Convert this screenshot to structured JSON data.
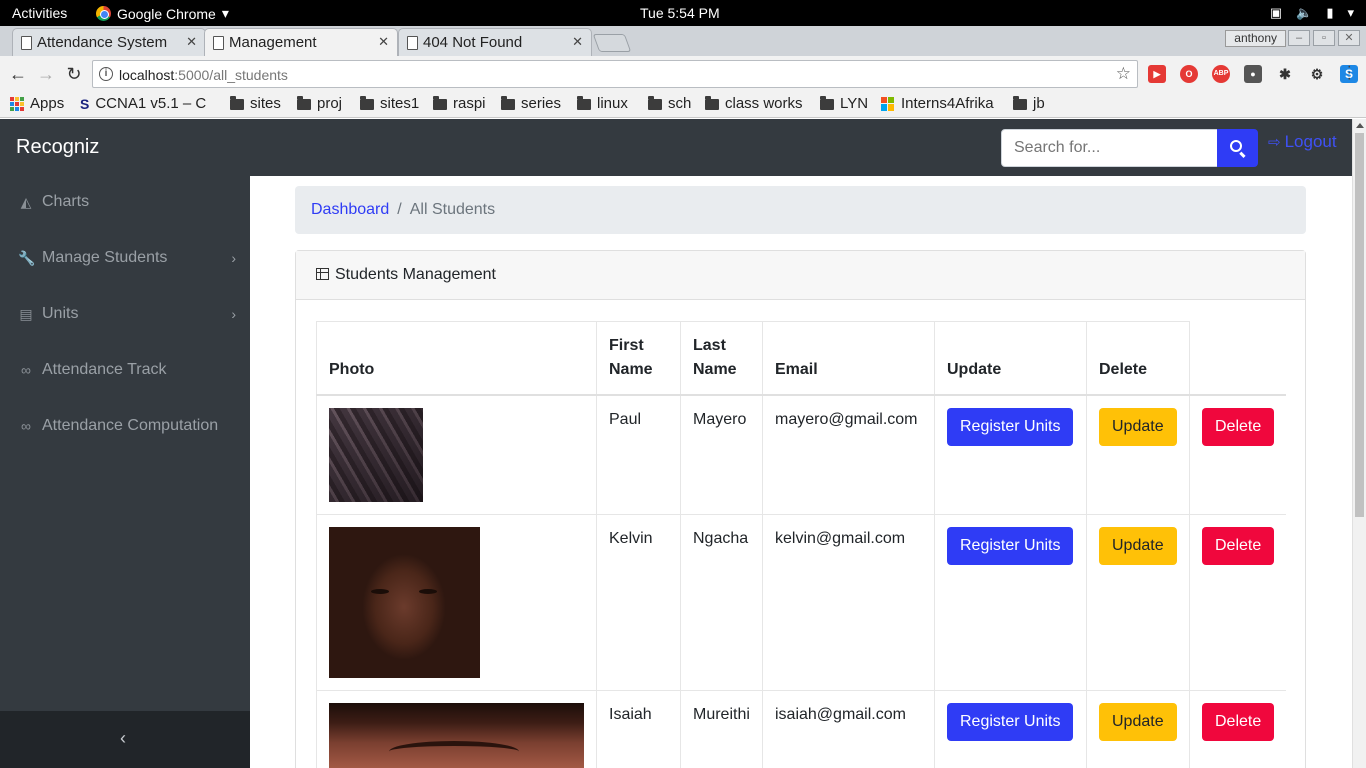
{
  "os_bar": {
    "activities": "Activities",
    "app_name": "Google Chrome",
    "clock": "Tue  5:54 PM"
  },
  "browser": {
    "tabs": [
      {
        "title": "Attendance System"
      },
      {
        "title": "Management"
      },
      {
        "title": "404 Not Found"
      }
    ],
    "active_tab": 1,
    "profile": "anthony",
    "url_host": "localhost",
    "url_path": ":5000/all_students",
    "bookmarks": [
      {
        "label": "Apps",
        "icon": "apps-icon"
      },
      {
        "label": "CCNA1 v5.1 – C",
        "icon": "ccna-icon"
      },
      {
        "label": "sites",
        "icon": "folder-icon"
      },
      {
        "label": "proj",
        "icon": "folder-icon"
      },
      {
        "label": "sites1",
        "icon": "folder-icon"
      },
      {
        "label": "raspi",
        "icon": "folder-icon"
      },
      {
        "label": "series",
        "icon": "folder-icon"
      },
      {
        "label": "linux",
        "icon": "folder-icon"
      },
      {
        "label": "sch",
        "icon": "folder-icon"
      },
      {
        "label": "class works",
        "icon": "folder-icon"
      },
      {
        "label": "LYN",
        "icon": "folder-icon"
      },
      {
        "label": "Interns4Afrika",
        "icon": "windows-icon"
      },
      {
        "label": "jb",
        "icon": "folder-icon"
      }
    ]
  },
  "app": {
    "brand": "Recogniz",
    "search_placeholder": "Search for...",
    "logout": "Logout",
    "sidebar": [
      {
        "label": "Charts",
        "icon": "area-chart-icon",
        "has_chevron": false
      },
      {
        "label": "Manage Students",
        "icon": "wrench-icon",
        "has_chevron": true
      },
      {
        "label": "Units",
        "icon": "file-icon",
        "has_chevron": true
      },
      {
        "label": "Attendance Track",
        "icon": "link-icon",
        "has_chevron": false
      },
      {
        "label": "Attendance Computation",
        "icon": "link-icon",
        "has_chevron": false
      }
    ],
    "breadcrumb": {
      "link": "Dashboard",
      "separator": "/",
      "current": "All Students"
    },
    "card_title": "Students Management",
    "table": {
      "headers": {
        "photo": "Photo",
        "first_name": "First Name",
        "last_name": "Last Name",
        "email": "Email",
        "update": "Update",
        "delete": "Delete"
      },
      "rows": [
        {
          "first": "Paul",
          "last": "Mayero",
          "email": "mayero@gmail.com",
          "register": "Register Units",
          "update": "Update",
          "delete": "Delete"
        },
        {
          "first": "Kelvin",
          "last": "Ngacha",
          "email": "kelvin@gmail.com",
          "register": "Register Units",
          "update": "Update",
          "delete": "Delete"
        },
        {
          "first": "Isaiah",
          "last": "Mureithi",
          "email": "isaiah@gmail.com",
          "register": "Register Units",
          "update": "Update",
          "delete": "Delete"
        }
      ]
    },
    "colors": {
      "primary": "#2f3cf5",
      "warning": "#ffc107",
      "danger": "#f0073d",
      "navbar": "#343a40"
    }
  }
}
